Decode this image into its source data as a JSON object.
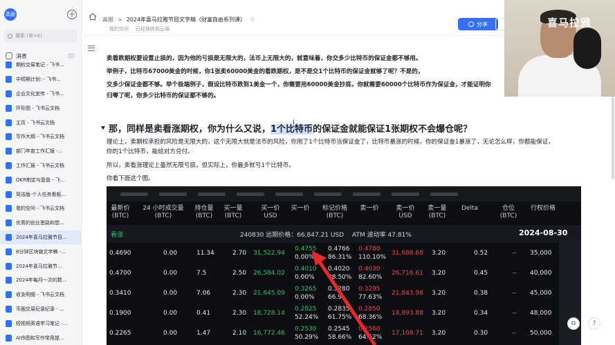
{
  "sidebar": {
    "avatar_text": "高朋",
    "search_placeholder": "搜索 (⌘+K)",
    "message_label": "消息",
    "message_more": "···",
    "items": [
      {
        "label": "期权交易笔记 - 飞书..."
      },
      {
        "label": "中短期计划: - 飞书..."
      },
      {
        "label": "企业文化宣传 - 飞书..."
      },
      {
        "label": "环形图 - 飞书云文档"
      },
      {
        "label": "主页 - 飞书云文档"
      },
      {
        "label": "写作大纲 - 飞书云文档"
      },
      {
        "label": "部门年度工作汇报 -..."
      },
      {
        "label": "工作汇报 - 飞书云文档"
      },
      {
        "label": "OKR制定与复盘 - 飞..."
      },
      {
        "label": "简洁版-个人任务看板..."
      },
      {
        "label": "我的空间 - 飞书云文档"
      },
      {
        "label": "优质的创业思路和想..."
      },
      {
        "label": "2024年喜马拉雅节目..."
      },
      {
        "label": "8分钟区块链文字稿 -..."
      },
      {
        "label": "2024年喜马拉雅节..."
      },
      {
        "label": "2024年每月一次的数..."
      },
      {
        "label": "收支明细 - 飞书云文档"
      },
      {
        "label": "币圈交易纪录纪录 - ..."
      },
      {
        "label": "短视频英语学习笔记 -..."
      },
      {
        "label": "AI作图和写作常用提..."
      }
    ]
  },
  "header": {
    "crumb_root": "高朋",
    "crumb_sep": ">",
    "crumb_current": "2024年喜马拉雅节目文字稿（财富自由系列课）",
    "star": "☆",
    "space": "我的空间",
    "saved": "已经保存到云端",
    "share_label": "分享"
  },
  "doc": {
    "p1": "卖看跌期权要设置止损的，因为他的亏损是无限大的，法币上无限大的，就意味着，你交多少比特币的保证金都不够用。",
    "p2": "举例子，比特币67000美金的时候，你1张卖60000美金的看跌期权，是不是交1个比特币的保证金就够了呢？不是的，",
    "p3a": "交多少保证金都不够。举个极端例子，假设比特币跌到1美金一个，你需要用60000美金抄底，你就需要60000个比特币作为保证金，才能证明你",
    "p3b": "归零了呢，你多少比特币的保证都不够的。",
    "heading_pre": "那，同样是卖看涨期权，你为什么又说，",
    "heading_hl": "1个比特币",
    "heading_post": "的保证金就能保证1张期权不会爆仓呢？",
    "b1a": "理论上，卖期权承担的风险是无限大的，这个无限大就是法币的风险，你用了1个比特币当保证金了，比特币暴涨的时候，你的保证金1暴涨了，无论怎么样，你都能保证，",
    "b1b": "你的1个比特币，能给对方兑付。",
    "b2": "所以，卖看涨理论上虽然无限亏损，但实际上，你最多就亏1个比特币。",
    "b3": "你看下面这个图。"
  },
  "table": {
    "headers": [
      {
        "l1": "最新价",
        "l2": "(BTC)"
      },
      {
        "l1": "24 小时成交量",
        "l2": "(BTC)"
      },
      {
        "l1": "持仓量",
        "l2": "(BTC)"
      },
      {
        "l1": "买一量",
        "l2": "(BTC)"
      },
      {
        "l1": "买一价",
        "l2": "USD"
      },
      {
        "l1": "买一价",
        "l2": ""
      },
      {
        "l1": "标记价格",
        "l2": "(BTC)"
      },
      {
        "l1": "卖一价",
        "l2": ""
      },
      {
        "l1": "卖一价",
        "l2": "USD"
      },
      {
        "l1": "卖一量",
        "l2": "(BTC)"
      },
      {
        "l1": "Delta",
        "l2": ""
      },
      {
        "l1": "仓位",
        "l2": "(BTC)"
      },
      {
        "l1": "行权价格",
        "l2": ""
      }
    ],
    "sub_left": "看涨",
    "sub_center": "240830 远期价格：66,847.21 USD",
    "sub_atm": "ATM 波动率 47.81%",
    "sub_date": "2024-08-30",
    "rows": [
      {
        "last": "0.4690",
        "vol": "0.00",
        "oi": "11.34",
        "bq": "2.70",
        "busd": "31,522.94",
        "bp": "0.4755",
        "bp2": "0.00%",
        "mark": "0.4766",
        "mark2": "86.31%",
        "ap": "0.4780",
        "ap2": "110.10%",
        "ausd": "31,688.68",
        "aq": "3.20",
        "delta": "0.52",
        "pos": "--",
        "strike": "35,000"
      },
      {
        "last": "0.4700",
        "vol": "0.00",
        "oi": "7.5",
        "bq": "2.50",
        "busd": "26,584.02",
        "bp": "0.4010",
        "bp2": "0.00%",
        "mark": "0.4020",
        "mark2": "88.50%",
        "ap": "0.4030",
        "ap2": "82.60%",
        "ausd": "26,716.61",
        "aq": "3.20",
        "delta": "0.45",
        "pos": "--",
        "strike": "40,000"
      },
      {
        "last": "0.3410",
        "vol": "0.00",
        "oi": "7.06",
        "bq": "2.30",
        "busd": "21,645.09",
        "bp": "0.3265",
        "bp2": "0.00%",
        "mark": "0.3280",
        "mark2": "66.9",
        "ap": "0.3295",
        "ap2": "77.63%",
        "ausd": "21,843.98",
        "aq": "3.20",
        "delta": "0.38",
        "pos": "--",
        "strike": "45,000"
      },
      {
        "last": "0.1900",
        "vol": "0.00",
        "oi": "0.41",
        "bq": "2.30",
        "busd": "18,728.14",
        "bp": "0.2825",
        "bp2": "52.24%",
        "mark": "0.2835",
        "mark2": "61.75%",
        "ap": "0.2850",
        "ap2": "68.36%",
        "ausd": "18,893.88",
        "aq": "3.20",
        "delta": "0.34",
        "pos": "--",
        "strike": "48,000"
      },
      {
        "last": "0.2265",
        "vol": "0.00",
        "oi": "1.47",
        "bq": "2.10",
        "busd": "16,772.46",
        "bp": "0.2530",
        "bp2": "50.29%",
        "mark": "0.2545",
        "mark2": "58.66%",
        "ap": "0.2560",
        "ap2": "64.62%",
        "ausd": "17,108.71",
        "aq": "3.20",
        "delta": "0.30",
        "pos": "--",
        "strike": "50,000"
      }
    ]
  },
  "cam": {
    "logo": "喜马拉雅"
  },
  "colors": {
    "accent": "#3370ff",
    "up": "#27c46b",
    "down": "#f0464b"
  }
}
